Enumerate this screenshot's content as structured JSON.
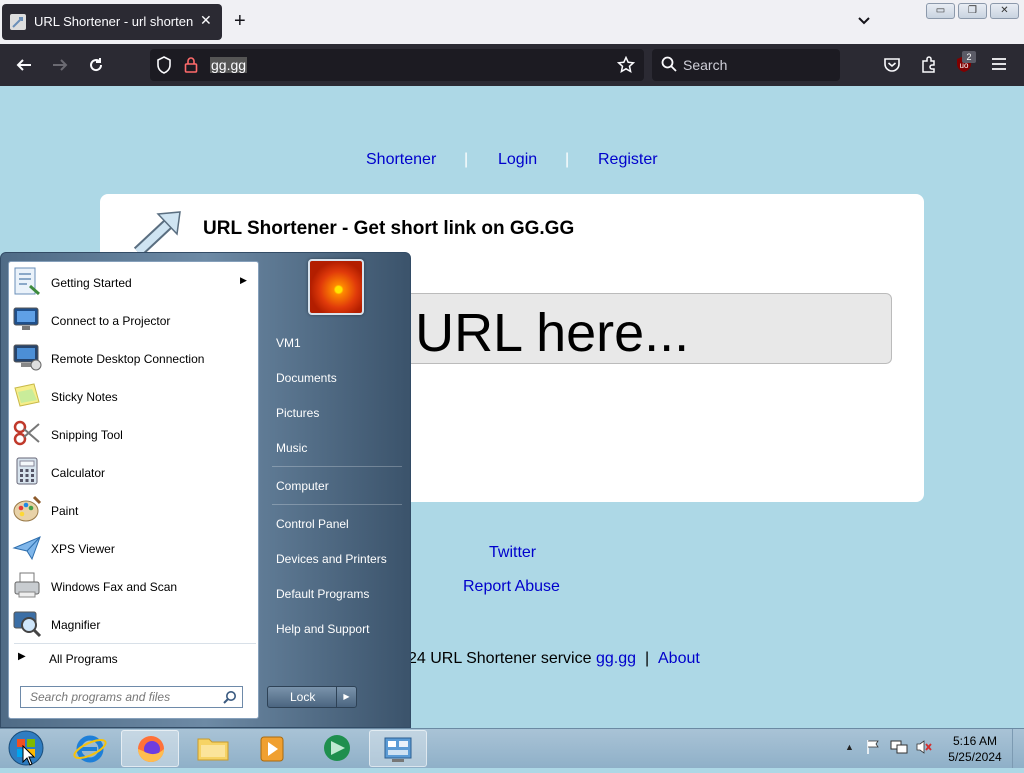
{
  "browser": {
    "tab_title": "URL Shortener - url shortening",
    "url": "gg.gg",
    "search_placeholder": "Search",
    "extension_badge": "2"
  },
  "page": {
    "top_links": [
      "Shortener",
      "Login",
      "Register"
    ],
    "separator": "|",
    "card_title": "URL Shortener - Get short link on GG.GG",
    "input_visible_text": "ng URL here...",
    "links": [
      "Twitter",
      "Report Abuse"
    ],
    "footer_text": "24 URL Shortener service",
    "footer_links": [
      "gg.gg",
      "About"
    ]
  },
  "start_menu": {
    "programs": [
      {
        "label": "Getting Started",
        "icon": "getting-started-icon",
        "submenu": true
      },
      {
        "label": "Connect to a Projector",
        "icon": "projector-icon"
      },
      {
        "label": "Remote Desktop Connection",
        "icon": "remote-desktop-icon"
      },
      {
        "label": "Sticky Notes",
        "icon": "sticky-notes-icon"
      },
      {
        "label": "Snipping Tool",
        "icon": "scissors-icon"
      },
      {
        "label": "Calculator",
        "icon": "calculator-icon"
      },
      {
        "label": "Paint",
        "icon": "paint-palette-icon"
      },
      {
        "label": "XPS Viewer",
        "icon": "paper-plane-icon"
      },
      {
        "label": "Windows Fax and Scan",
        "icon": "fax-icon"
      },
      {
        "label": "Magnifier",
        "icon": "magnifier-icon"
      }
    ],
    "all_programs": "All Programs",
    "search_placeholder": "Search programs and files",
    "right_items": [
      "VM1",
      "Documents",
      "Pictures",
      "Music",
      "Computer",
      "Control Panel",
      "Devices and Printers",
      "Default Programs",
      "Help and Support"
    ],
    "lock_label": "Lock"
  },
  "taskbar": {
    "time": "5:16 AM",
    "date": "5/25/2024"
  }
}
